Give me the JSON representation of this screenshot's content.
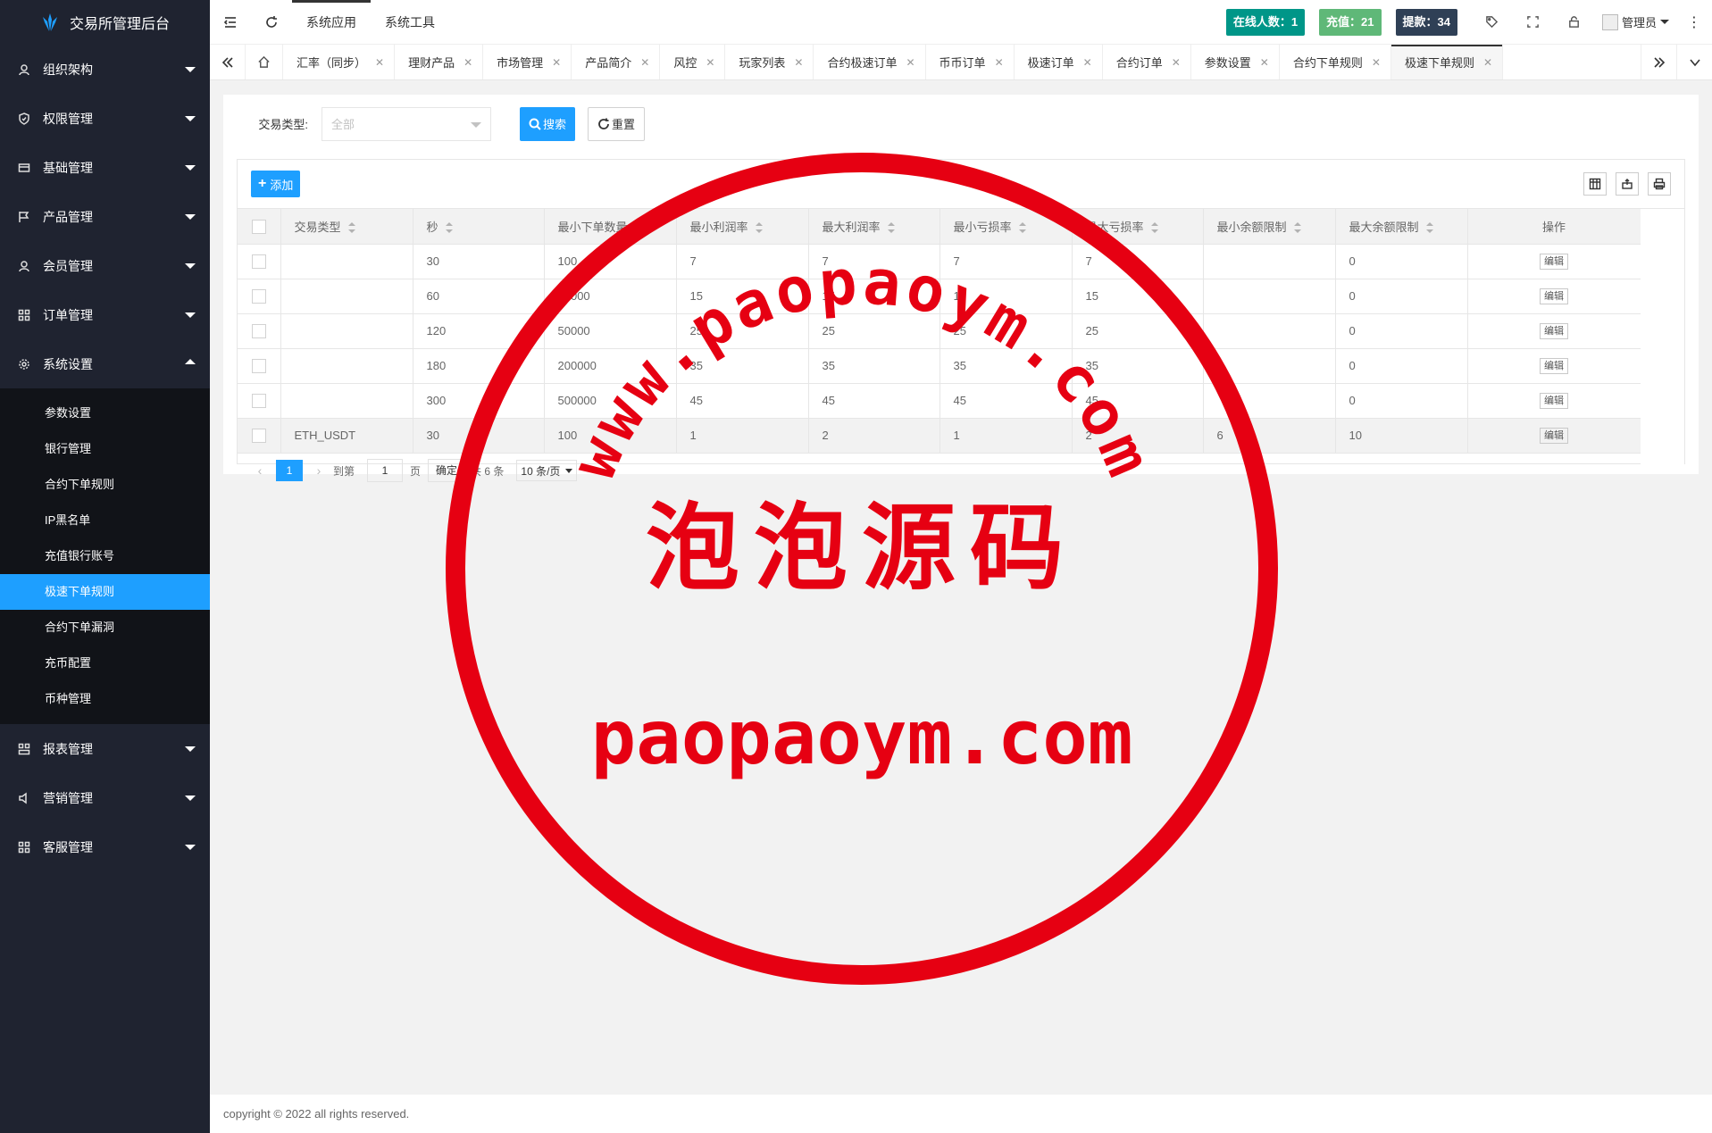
{
  "sidebar": {
    "app_title": "交易所管理后台",
    "menu": [
      {
        "label": "组织架构",
        "icon": "users-icon"
      },
      {
        "label": "权限管理",
        "icon": "shield-icon"
      },
      {
        "label": "基础管理",
        "icon": "card-icon"
      },
      {
        "label": "产品管理",
        "icon": "flag-icon"
      },
      {
        "label": "会员管理",
        "icon": "user-icon"
      },
      {
        "label": "订单管理",
        "icon": "grid-icon"
      },
      {
        "label": "系统设置",
        "icon": "gear-icon"
      }
    ],
    "submenu": [
      {
        "label": "参数设置"
      },
      {
        "label": "银行管理"
      },
      {
        "label": "合约下单规则"
      },
      {
        "label": "IP黑名单"
      },
      {
        "label": "充值银行账号"
      },
      {
        "label": "极速下单规则"
      },
      {
        "label": "合约下单漏洞"
      },
      {
        "label": "充币配置"
      },
      {
        "label": "币种管理"
      }
    ],
    "menu_after": [
      {
        "label": "报表管理",
        "icon": "report-icon"
      },
      {
        "label": "营销管理",
        "icon": "speaker-icon"
      },
      {
        "label": "客服管理",
        "icon": "grid-icon"
      }
    ]
  },
  "header": {
    "nav": [
      "系统应用",
      "系统工具"
    ],
    "stats": {
      "online": "在线人数：1",
      "recharge": "充值：21",
      "withdraw": "提款：34"
    },
    "stat_colors": {
      "online": "#009688",
      "recharge": "#5fb878",
      "withdraw": "#2f4056"
    },
    "user": "管理员",
    "more": "⋮"
  },
  "tabs": [
    {
      "label": "汇率（同步）"
    },
    {
      "label": "理财产品"
    },
    {
      "label": "市场管理"
    },
    {
      "label": "产品简介"
    },
    {
      "label": "风控"
    },
    {
      "label": "玩家列表"
    },
    {
      "label": "合约极速订单"
    },
    {
      "label": "币币订单"
    },
    {
      "label": "极速订单"
    },
    {
      "label": "合约订单"
    },
    {
      "label": "参数设置"
    },
    {
      "label": "合约下单规则"
    },
    {
      "label": "极速下单规则"
    }
  ],
  "search": {
    "label": "交易类型:",
    "select_placeholder": "全部",
    "search_btn": "搜索",
    "reset_btn": "重置"
  },
  "toolbar": {
    "add_btn": "添加"
  },
  "table": {
    "columns": [
      "交易类型",
      "秒",
      "最小下单数量",
      "最小利润率",
      "最大利润率",
      "最小亏损率",
      "最大亏损率",
      "最小余额限制",
      "最大余额限制",
      "操作"
    ],
    "rows": [
      [
        "",
        "30",
        "100",
        "7",
        "7",
        "7",
        "7",
        "",
        "0"
      ],
      [
        "",
        "60",
        "20000",
        "15",
        "15",
        "15",
        "15",
        "",
        "0"
      ],
      [
        "",
        "120",
        "50000",
        "25",
        "25",
        "25",
        "25",
        "",
        "0"
      ],
      [
        "",
        "180",
        "200000",
        "35",
        "35",
        "35",
        "35",
        "",
        "0"
      ],
      [
        "",
        "300",
        "500000",
        "45",
        "45",
        "45",
        "45",
        "",
        "0"
      ],
      [
        "ETH_USDT",
        "30",
        "100",
        "1",
        "2",
        "1",
        "2",
        "6",
        "10"
      ]
    ],
    "edit_label": "编辑"
  },
  "pager": {
    "current": "1",
    "goto_prefix": "到第",
    "goto_value": "1",
    "goto_suffix": "页",
    "confirm": "确定",
    "total": "共 6 条",
    "page_size": "10 条/页"
  },
  "footer": {
    "copyright": "copyright © 2022 all rights reserved."
  },
  "watermark": {
    "top_text": "www.paopaoym.com",
    "center_text": "泡泡源码",
    "bottom_text": "paopaoym.com",
    "color": "#e60012"
  }
}
